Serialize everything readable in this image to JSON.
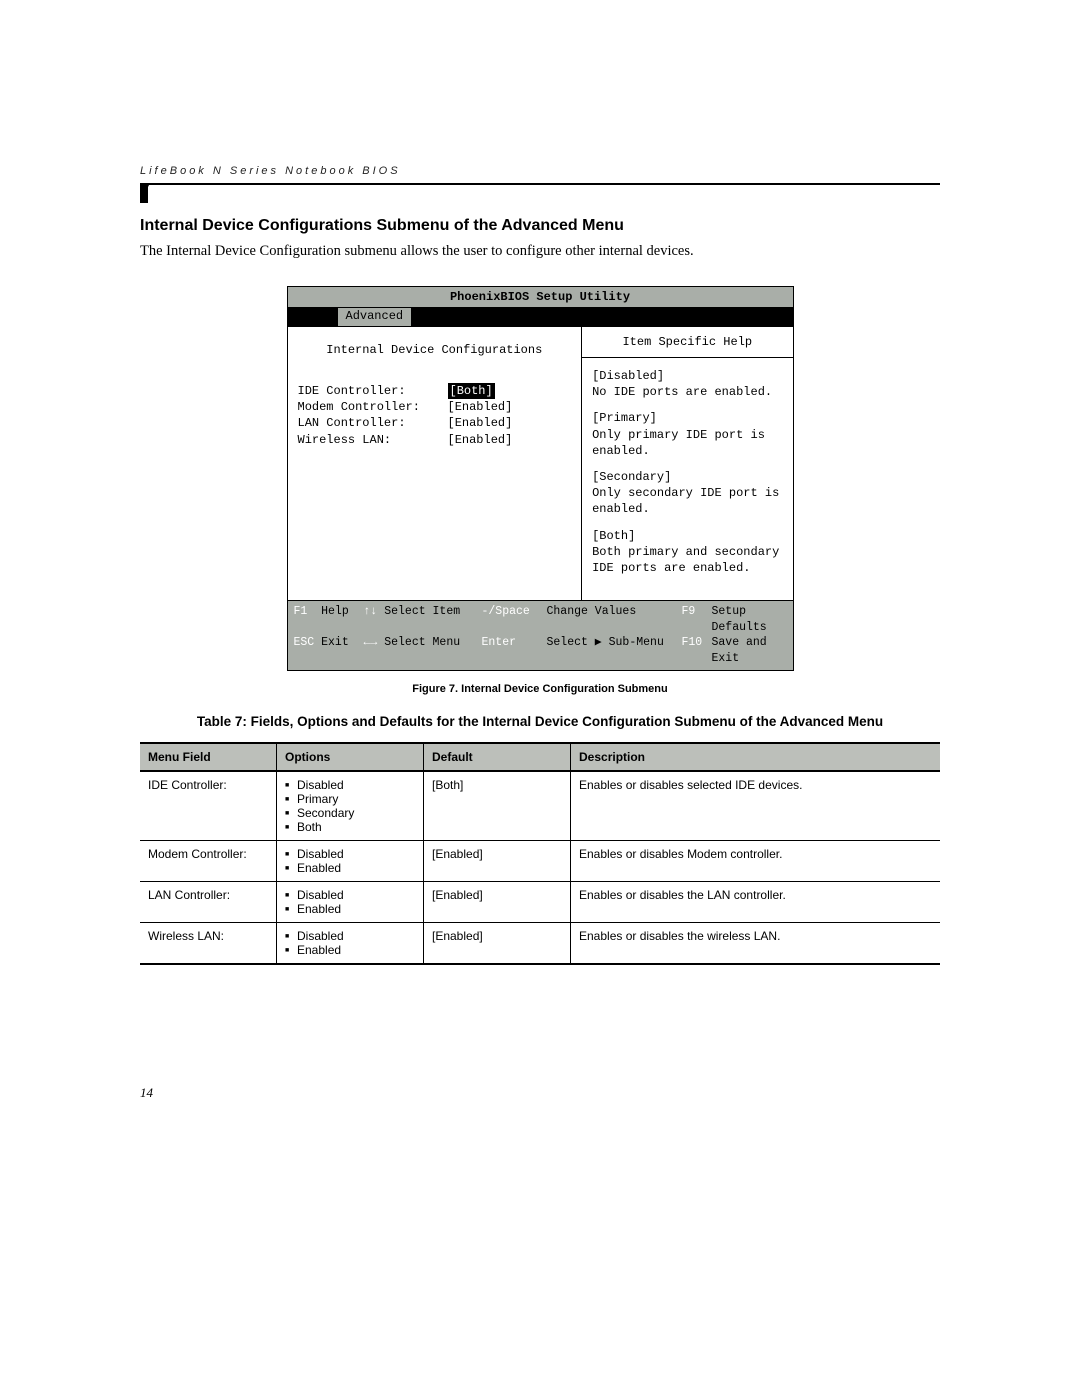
{
  "running_head": "LifeBook N Series Notebook BIOS",
  "section_title": "Internal Device Configurations Submenu of the Advanced Menu",
  "intro": "The Internal Device Configuration submenu allows the user to configure other internal devices.",
  "bios": {
    "title": "PhoenixBIOS Setup Utility",
    "tab": "Advanced",
    "sub_title": "Internal Device Configurations",
    "help_title": "Item Specific Help",
    "rows": [
      {
        "label": "IDE Controller:",
        "value": "[Both]",
        "selected": true
      },
      {
        "label": "Modem Controller:",
        "value": "[Enabled]",
        "selected": false
      },
      {
        "label": "LAN Controller:",
        "value": "[Enabled]",
        "selected": false
      },
      {
        "label": "Wireless LAN:",
        "value": "[Enabled]",
        "selected": false
      }
    ],
    "help": [
      "[Disabled]\nNo IDE ports are enabled.",
      "[Primary]\nOnly primary IDE port is enabled.",
      "[Secondary]\nOnly secondary IDE port is enabled.",
      "[Both]\nBoth primary and secondary IDE ports are enabled."
    ],
    "footer": {
      "f1": "F1",
      "help": "Help",
      "updn": "↑↓",
      "sel_item": "Select Item",
      "pm": "-/Space",
      "chg": "Change Values",
      "f9": "F9",
      "defaults": "Setup Defaults",
      "esc": "ESC",
      "exit": "Exit",
      "lr": "←→",
      "sel_menu": "Select Menu",
      "enter": "Enter",
      "sub": "Select ▶ Sub-Menu",
      "f10": "F10",
      "save": "Save and Exit"
    }
  },
  "figure_caption": "Figure 7.  Internal Device Configuration Submenu",
  "table_title": "Table 7: Fields, Options and Defaults for the Internal Device Configuration Submenu of the Advanced Menu",
  "table": {
    "headers": [
      "Menu Field",
      "Options",
      "Default",
      "Description"
    ],
    "rows": [
      {
        "field": "IDE Controller:",
        "options": [
          "Disabled",
          "Primary",
          "Secondary",
          "Both"
        ],
        "default": "[Both]",
        "desc": "Enables or disables selected IDE devices."
      },
      {
        "field": "Modem Controller:",
        "options": [
          "Disabled",
          "Enabled"
        ],
        "default": "[Enabled]",
        "desc": "Enables or disables Modem controller."
      },
      {
        "field": "LAN Controller:",
        "options": [
          "Disabled",
          "Enabled"
        ],
        "default": "[Enabled]",
        "desc": "Enables or disables the LAN controller."
      },
      {
        "field": "Wireless LAN:",
        "options": [
          "Disabled",
          "Enabled"
        ],
        "default": "[Enabled]",
        "desc": "Enables or disables the wireless LAN."
      }
    ]
  },
  "page_number": "14"
}
